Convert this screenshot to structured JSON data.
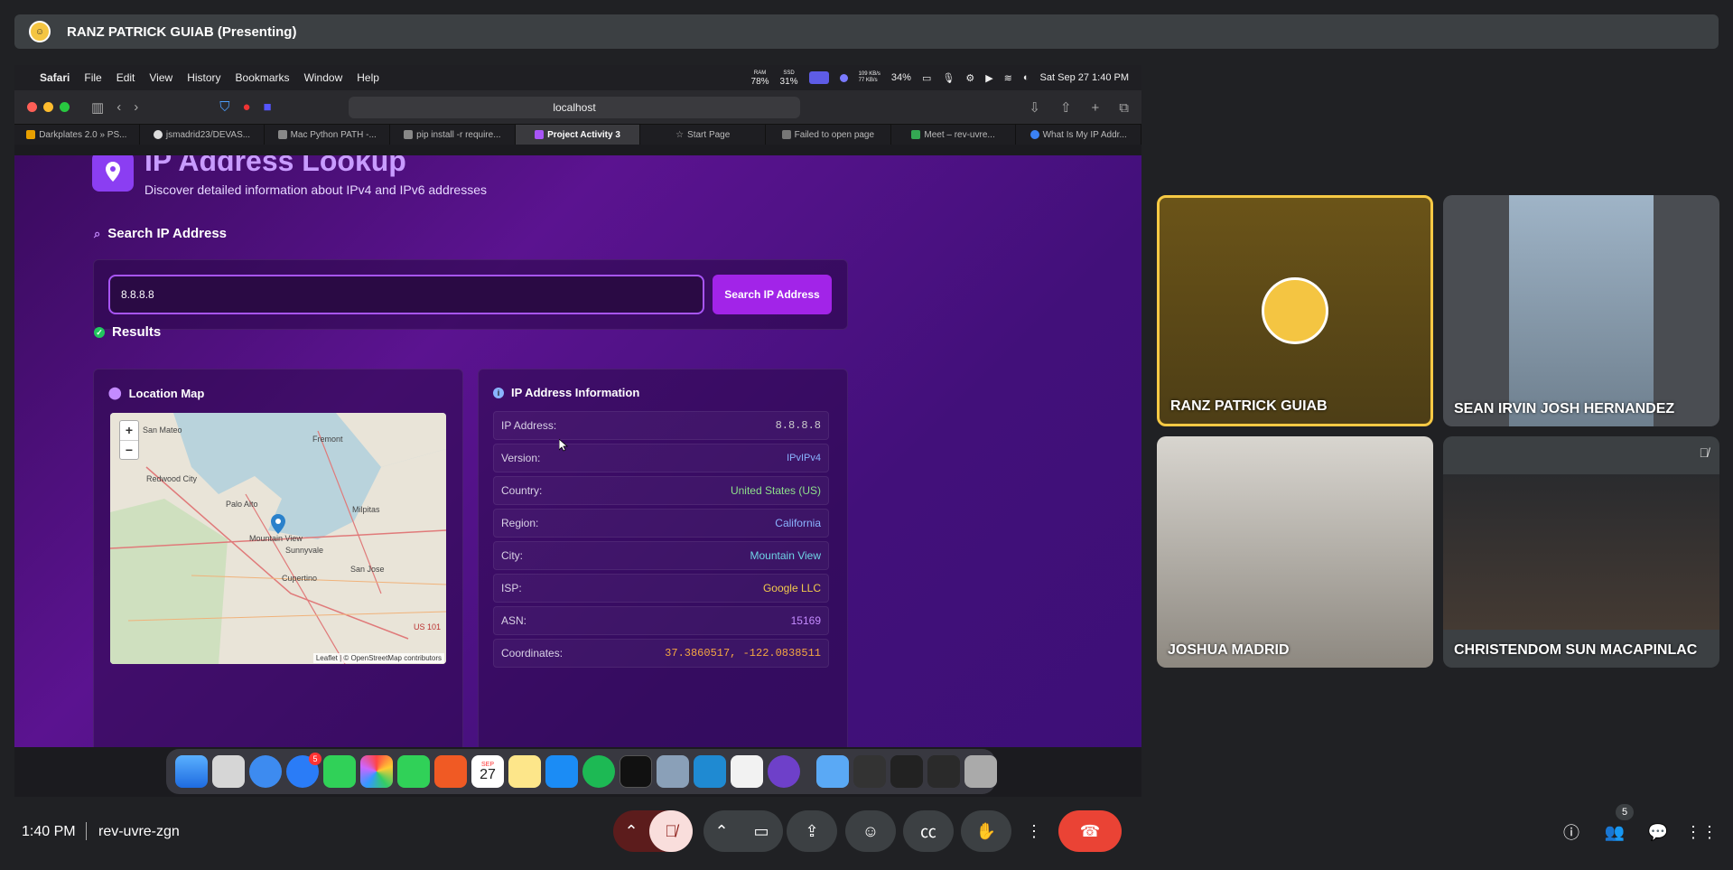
{
  "meeting": {
    "presenter_label": "RANZ PATRICK GUIAB (Presenting)",
    "time": "1:40 PM",
    "code": "rev-uvre-zgn",
    "participant_count": "5"
  },
  "shared_screen": {
    "menubar": {
      "app": "Safari",
      "items": [
        "File",
        "Edit",
        "View",
        "History",
        "Bookmarks",
        "Window",
        "Help"
      ],
      "ram_label": "RAM",
      "ram": "78%",
      "ssd_label": "SSD",
      "ssd": "31%",
      "net_up": "109 KB/s",
      "net_down": "77 KB/s",
      "battery": "34%",
      "datetime": "Sat Sep 27  1:40 PM"
    },
    "address": "localhost",
    "tabs": [
      "Darkplates 2.0 » PS...",
      "jsmadrid23/DEVAS...",
      "Mac Python PATH -...",
      "pip install -r require...",
      "Project Activity 3",
      "Start Page",
      "Failed to open page",
      "Meet – rev-uvre...",
      "What Is My IP Addr..."
    ],
    "page": {
      "title": "IP Address Lookup",
      "subtitle": "Discover detailed information about IPv4 and IPv6 addresses",
      "search_heading": "Search IP Address",
      "input_value": "8.8.8.8",
      "search_button": "Search IP Address",
      "results_heading": "Results",
      "map_heading": "Location Map",
      "info_heading": "IP Address Information",
      "map_labels": [
        "San Mateo",
        "Fremont",
        "Redwood City",
        "Palo Alto",
        "Milpitas",
        "Mountain View",
        "Sunnyvale",
        "San Jose",
        "Cupertino",
        "US 101"
      ],
      "attribution": "Leaflet | © OpenStreetMap contributors",
      "info": [
        {
          "label": "IP Address:",
          "value": "8.8.8.8"
        },
        {
          "label": "Version:",
          "value": "IPvIPv4"
        },
        {
          "label": "Country:",
          "value": "United States (US)"
        },
        {
          "label": "Region:",
          "value": "California"
        },
        {
          "label": "City:",
          "value": "Mountain View"
        },
        {
          "label": "ISP:",
          "value": "Google LLC"
        },
        {
          "label": "ASN:",
          "value": "15169"
        },
        {
          "label": "Coordinates:",
          "value": "37.3860517, -122.0838511"
        }
      ]
    },
    "dock_calendar": {
      "month": "SEP",
      "day": "27"
    },
    "dock_badge": "5"
  },
  "participants": [
    {
      "name": "RANZ PATRICK GUIAB"
    },
    {
      "name": "SEAN IRVIN JOSH HERNANDEZ"
    },
    {
      "name": "JOSHUA MADRID"
    },
    {
      "name": "CHRISTENDOM SUN MACAPINLAC"
    }
  ]
}
